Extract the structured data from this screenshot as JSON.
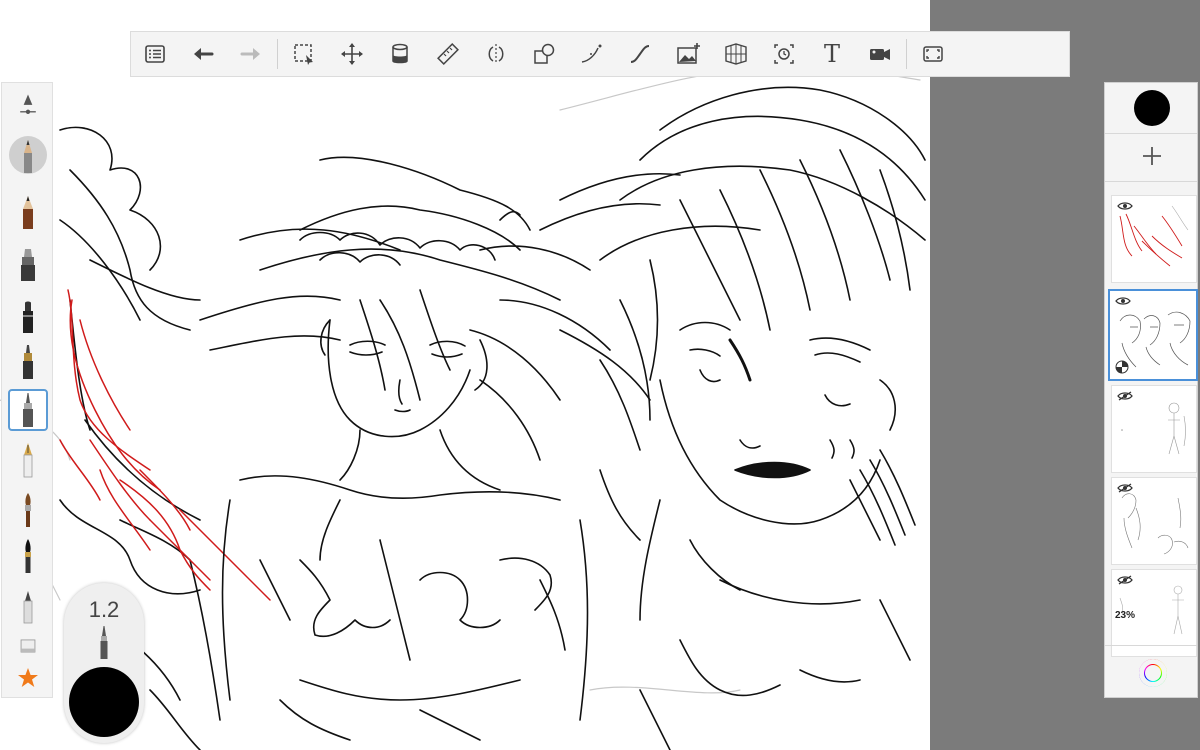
{
  "toolbar": {
    "tools": [
      {
        "name": "layer-menu-icon"
      },
      {
        "name": "undo-icon"
      },
      {
        "name": "redo-icon"
      },
      {
        "name": "selection-icon"
      },
      {
        "name": "transform-icon"
      },
      {
        "name": "fill-icon"
      },
      {
        "name": "ruler-icon"
      },
      {
        "name": "symmetry-icon"
      },
      {
        "name": "shapes-icon"
      },
      {
        "name": "curve-icon"
      },
      {
        "name": "stroke-icon"
      },
      {
        "name": "import-image-icon"
      },
      {
        "name": "perspective-icon"
      },
      {
        "name": "time-lapse-icon"
      },
      {
        "name": "text-icon",
        "glyph": "T"
      },
      {
        "name": "record-icon"
      },
      {
        "name": "fullscreen-icon"
      }
    ]
  },
  "brush_palette": {
    "selected_index": 7,
    "brushes": [
      "pencil",
      "pencil-hb",
      "marker",
      "felt-tip",
      "ink-pen",
      "technical-pen",
      "fountain-pen",
      "paint-brush",
      "calligraphy-brush",
      "airbrush",
      "eraser",
      "favorites-star"
    ]
  },
  "brush_size": {
    "value": "1.2"
  },
  "colors": {
    "current": "#000000",
    "ink": "#111111",
    "red_layer": "#d01b1b",
    "selection_accent": "#4a90d9",
    "favorite_star": "#f07a1a",
    "panel_bg": "#f4f4f4",
    "workspace_bg": "#7b7b7b"
  },
  "layers": {
    "add_label": "+",
    "items": [
      {
        "name": "layer-red-sketch",
        "visible": true,
        "selected": false,
        "opacity_label": ""
      },
      {
        "name": "layer-main-lineart",
        "visible": true,
        "selected": true,
        "opacity_label": ""
      },
      {
        "name": "layer-figure-sketch",
        "visible": false,
        "selected": false,
        "opacity_label": ""
      },
      {
        "name": "layer-rough-figures",
        "visible": false,
        "selected": false,
        "opacity_label": ""
      },
      {
        "name": "layer-faint-figure",
        "visible": false,
        "selected": false,
        "opacity_label": "23%"
      }
    ]
  }
}
